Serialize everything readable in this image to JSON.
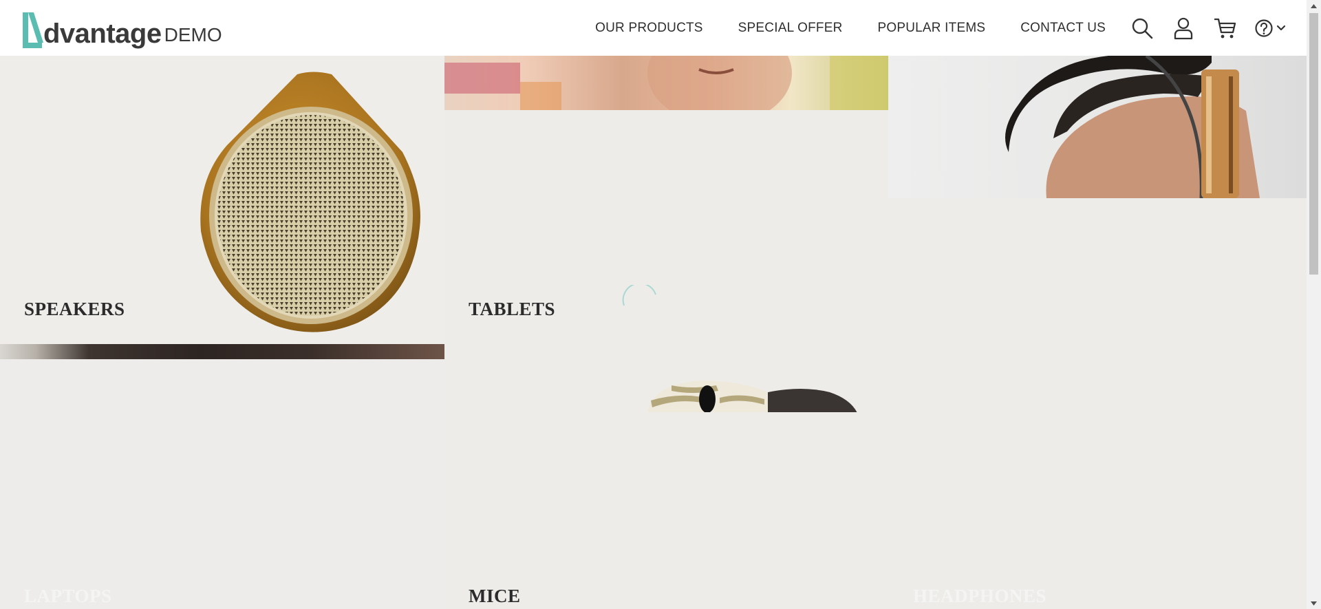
{
  "logo": {
    "word": "dvantage",
    "suffix": "DEMO"
  },
  "nav": {
    "links": [
      "OUR PRODUCTS",
      "SPECIAL OFFER",
      "POPULAR ITEMS",
      "CONTACT US"
    ]
  },
  "icons": [
    "search-icon",
    "user-icon",
    "cart-icon",
    "help-icon",
    "chevron-down-icon"
  ],
  "categories": {
    "speakers": "SPEAKERS",
    "tablets": "TABLETS",
    "laptops": "LAPTOPS",
    "mice": "MICE",
    "headphones": "HEADPHONES"
  },
  "colors": {
    "brand": "#5bbcb1",
    "text": "#2f2f2f",
    "tile_bg": "#ecebe8"
  }
}
